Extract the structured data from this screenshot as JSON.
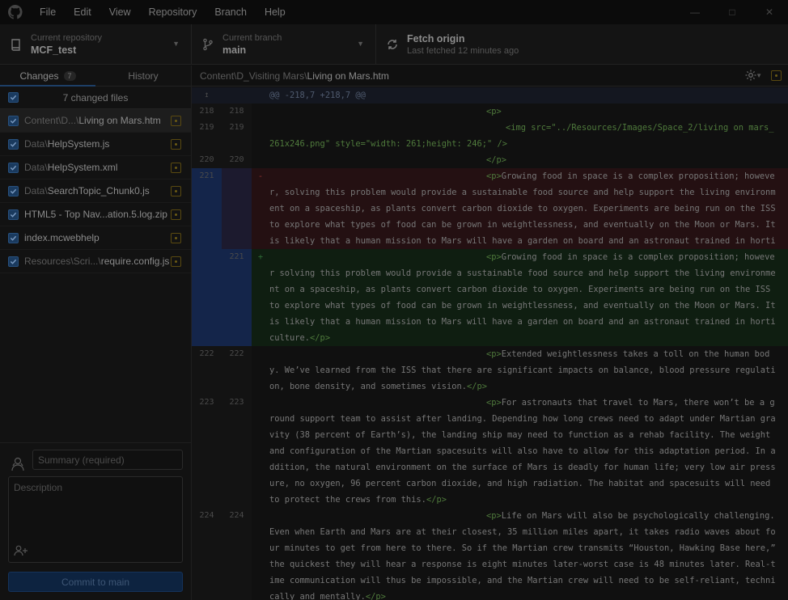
{
  "menu": {
    "items": [
      "File",
      "Edit",
      "View",
      "Repository",
      "Branch",
      "Help"
    ]
  },
  "toolbar": {
    "repo_label": "Current repository",
    "repo_value": "MCF_test",
    "branch_label": "Current branch",
    "branch_value": "main",
    "fetch_label": "Fetch origin",
    "fetch_sub": "Last fetched 12 minutes ago"
  },
  "sidebar": {
    "tab_changes": "Changes",
    "tab_changes_count": "7",
    "tab_history": "History",
    "changed_files_label": "7 changed files",
    "files": [
      {
        "dir": "Content\\D...\\",
        "name": "Living on Mars.htm"
      },
      {
        "dir": "Data\\",
        "name": "HelpSystem.js"
      },
      {
        "dir": "Data\\",
        "name": "HelpSystem.xml"
      },
      {
        "dir": "Data\\",
        "name": "SearchTopic_Chunk0.js"
      },
      {
        "dir": "",
        "name": "HTML5 - Top Nav...ation.5.log.zip"
      },
      {
        "dir": "",
        "name": "index.mcwebhelp"
      },
      {
        "dir": "Resources\\Scri...\\",
        "name": "require.config.js"
      }
    ],
    "summary_placeholder": "Summary (required)",
    "description_placeholder": "Description",
    "commit_button": "Commit to main"
  },
  "diff": {
    "path_dir": "Content\\D_Visiting Mars\\",
    "path_file": "Living on Mars.htm",
    "hunk_header": "@@ -218,7 +218,7 @@",
    "rows": [
      {
        "type": "ctx",
        "old": "218",
        "new": "218",
        "tag1": "<p>",
        "text": ""
      },
      {
        "type": "ctx",
        "old": "219",
        "new": "219",
        "img": true,
        "text": "<img src=\"../Resources/Images/Space_2/living on mars_261x246.png\" style=\"width: 261;height: 246;\" />"
      },
      {
        "type": "ctx",
        "old": "220",
        "new": "220",
        "tag1": "</p>",
        "text": ""
      },
      {
        "type": "del",
        "old": "221",
        "new": "",
        "sign": "-",
        "tag1": "<p>",
        "text": "Growing food in space is a complex proposition; however, solving this problem would provide a sustainable food source and help support the living environment on a spaceship, as plants convert carbon dioxide to oxygen. Experiments are being run on the ISS to explore what types of food can be grown in weightlessness, and eventually on the Moon or Mars. It is likely that a human mission to Mars will have a garden on board and an astronaut trained in horticultur"
      },
      {
        "type": "add",
        "old": "",
        "new": "221",
        "sign": "+",
        "tag1": "<p>",
        "text": "Growing food in space is a complex proposition; however solving this problem would provide a sustainable food source and help support the living environment on a spaceship, as plants convert carbon dioxide to oxygen. Experiments are being run on the ISS to explore what types of food can be grown in weightlessness, and eventually on the Moon or Mars. It is likely that a human mission to Mars will have a garden on board and an astronaut trained in horticulture.",
        "tag2": "</p>"
      },
      {
        "type": "ctx",
        "old": "222",
        "new": "222",
        "tag1": "<p>",
        "text": "Extended weightlessness takes a toll on the human body. We’ve learned from the ISS that there are significant impacts on balance, blood pressure regulation, bone density, and sometimes vision.",
        "tag2": "</p>"
      },
      {
        "type": "ctx",
        "old": "223",
        "new": "223",
        "tag1": "<p>",
        "text": "For astronauts that travel to Mars, there won’t be a ground support team to assist after landing. Depending how long crews need to adapt under Martian gravity (38 percent of Earth’s), the landing ship may need to function as a rehab facility. The weight and configuration of the Martian spacesuits will also have to allow for this adaptation period. In addition, the natural environment on the surface of Mars is deadly for human life; very low air pressure, no oxygen, 96 percent carbon dioxide, and high radiation. The habitat and spacesuits will need to protect the crews from this.",
        "tag2": "</p>"
      },
      {
        "type": "ctx",
        "old": "224",
        "new": "224",
        "tag1": "<p>",
        "text": "Life on Mars will also be psychologically challenging. Even when Earth and Mars are at their closest, 35 million miles apart, it takes radio waves about four minutes to get from here to there. So if the Martian crew transmits “Houston, Hawking Base here,” the quickest they will hear a response is eight minutes later-worst case is 48 minutes later. Real-time communication will thus be impossible, and the Martian crew will need to be self-reliant, technically and mentally.",
        "tag2": "</p>"
      }
    ]
  }
}
